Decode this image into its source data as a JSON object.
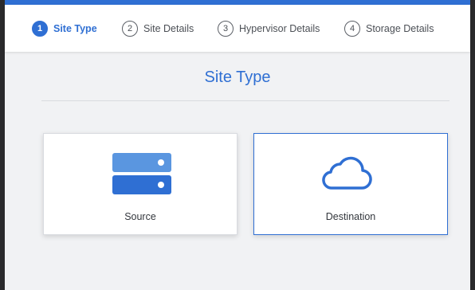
{
  "stepper": {
    "steps": [
      {
        "num": "1",
        "label": "Site Type",
        "active": true
      },
      {
        "num": "2",
        "label": "Site Details",
        "active": false
      },
      {
        "num": "3",
        "label": "Hypervisor Details",
        "active": false
      },
      {
        "num": "4",
        "label": "Storage Details",
        "active": false
      }
    ]
  },
  "main": {
    "heading": "Site Type",
    "options": [
      {
        "label": "Source",
        "icon": "server-icon",
        "selected": false
      },
      {
        "label": "Destination",
        "icon": "cloud-icon",
        "selected": true
      }
    ]
  },
  "colors": {
    "accent": "#2f6fd3",
    "server_top": "#5a96e0",
    "server_bottom": "#2f6fd3",
    "cloud_stroke": "#2f6fd3"
  }
}
